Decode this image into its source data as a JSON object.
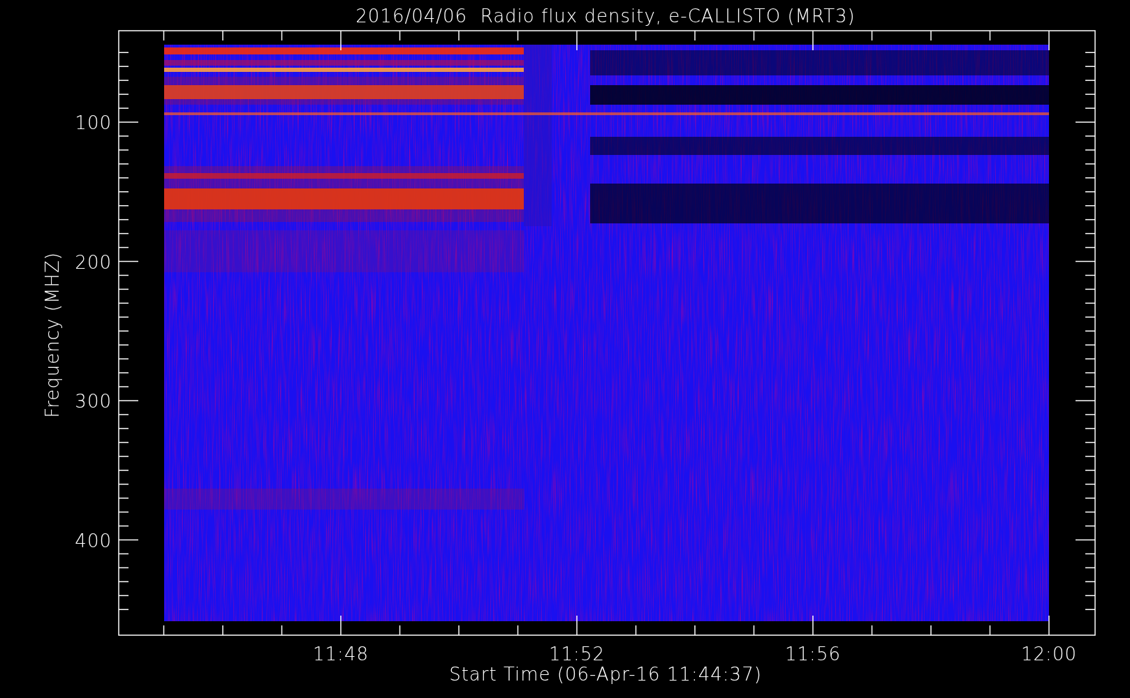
{
  "title": "2016/04/06  Radio flux density, e-CALLISTO (MRT3)",
  "y_axis": {
    "label": "Frequency (MHZ)",
    "tick_labels": [
      "100",
      "200",
      "300",
      "400"
    ]
  },
  "x_axis": {
    "label": "Start Time (06-Apr-16 11:44:37)",
    "tick_labels": [
      "11:48",
      "11:52",
      "11:56",
      "12:00"
    ]
  }
}
